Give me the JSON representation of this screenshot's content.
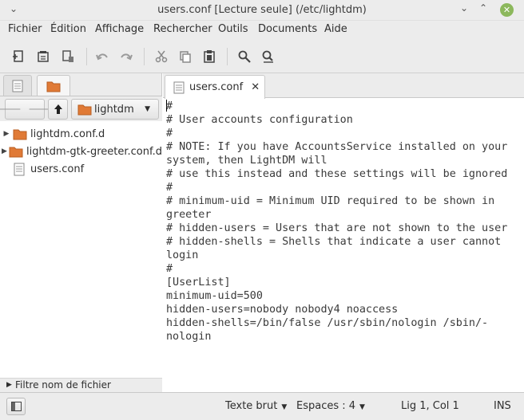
{
  "window": {
    "title": "users.conf [Lecture seule] (/etc/lightdm)",
    "menu_glyph": "⌄",
    "minimize_glyph": "⌄",
    "maximize_glyph": "⌃",
    "close_glyph": "✕",
    "close_color": "#8cb85c"
  },
  "menubar": {
    "items": [
      "Fichier",
      "Édition",
      "Affichage",
      "Rechercher",
      "Outils",
      "Documents",
      "Aide"
    ]
  },
  "toolbar": {
    "icons": [
      "new-document-icon",
      "open-document-icon",
      "save-document-icon",
      "undo-icon",
      "redo-icon",
      "cut-icon",
      "copy-icon",
      "paste-icon",
      "find-icon",
      "find-replace-icon"
    ]
  },
  "side_panel": {
    "location": "lightdm",
    "files": [
      {
        "name": "lightdm.conf.d",
        "type": "folder",
        "expander": "▶"
      },
      {
        "name": "lightdm-gtk-greeter.conf.d",
        "type": "folder",
        "expander": "▶"
      },
      {
        "name": "users.conf",
        "type": "file",
        "expander": ""
      }
    ],
    "filter_label": "Filtre nom de fichier",
    "filter_expander": "▶"
  },
  "editor": {
    "tab_label": "users.conf",
    "tab_close": "✕",
    "lines": [
      "#",
      "# User accounts configuration",
      "#",
      "# NOTE: If you have AccountsService installed on your",
      "system, then LightDM will",
      "# use this instead and these settings will be ignored",
      "#",
      "# minimum-uid = Minimum UID required to be shown in",
      "greeter",
      "# hidden-users = Users that are not shown to the user",
      "# hidden-shells = Shells that indicate a user cannot",
      "login",
      "#",
      "[UserList]",
      "minimum-uid=500",
      "hidden-users=nobody nobody4 noaccess",
      "hidden-shells=/bin/false /usr/sbin/nologin /sbin/-",
      "nologin"
    ]
  },
  "statusbar": {
    "language": "Texte brut",
    "indent": "Espaces : 4",
    "position": "Lig 1, Col 1",
    "mode": "INS"
  },
  "colors": {
    "chrome": "#ececec",
    "folder": "#e07a36",
    "text": "#3a3a3a"
  }
}
